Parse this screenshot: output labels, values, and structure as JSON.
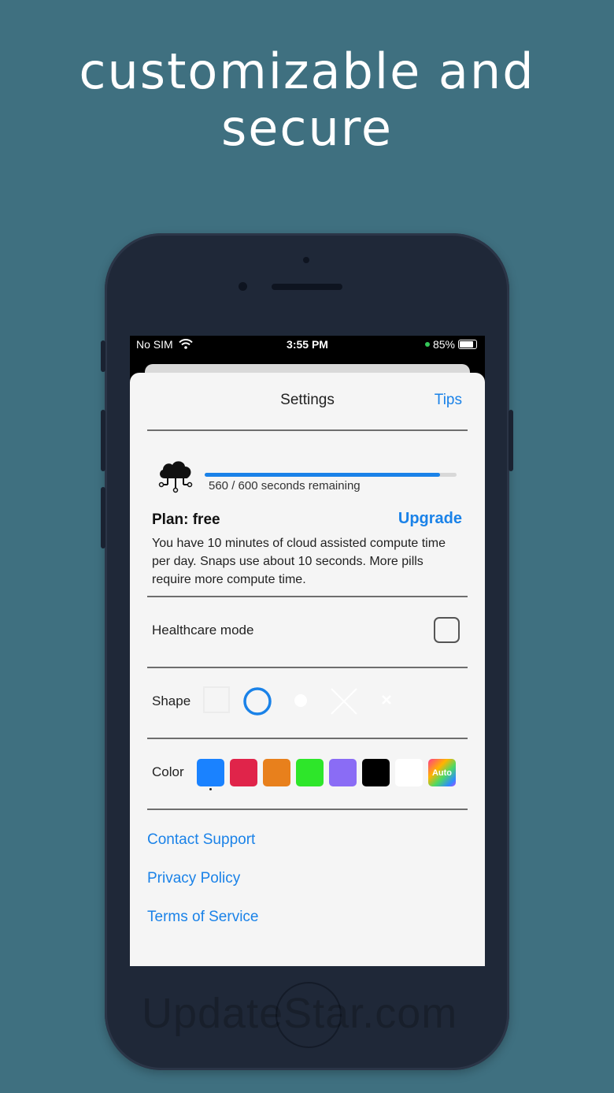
{
  "headline": {
    "line1": "customizable and",
    "line2": "secure"
  },
  "status_bar": {
    "carrier": "No SIM",
    "time": "3:55 PM",
    "battery": "85%"
  },
  "settings": {
    "title": "Settings",
    "tips_label": "Tips",
    "usage": {
      "used": "560",
      "total": "600",
      "text": "560 /  600 seconds remaining",
      "fraction": 0.933
    },
    "plan_label": "Plan: free",
    "upgrade_label": "Upgrade",
    "plan_description": "You have 10 minutes of cloud assisted compute time per day. Snaps use about 10 seconds. More pills require more compute time.",
    "healthcare_label": "Healthcare mode",
    "healthcare_checked": false,
    "shape_label": "Shape",
    "shapes": [
      "square-icon",
      "circle-icon",
      "dot-icon",
      "cross-icon",
      "small-cross-icon"
    ],
    "selected_shape": "circle",
    "color_label": "Color",
    "colors": [
      "#1a82ff",
      "#e0244a",
      "#e8801c",
      "#2ee62a",
      "#8a6cf5",
      "#000000",
      "#ffffff",
      "auto"
    ],
    "selected_color": "#1a82ff",
    "auto_label": "Auto",
    "links": {
      "contact": "Contact Support",
      "privacy": "Privacy Policy",
      "terms": "Terms of Service"
    }
  },
  "watermark": "UpdateStar.com"
}
